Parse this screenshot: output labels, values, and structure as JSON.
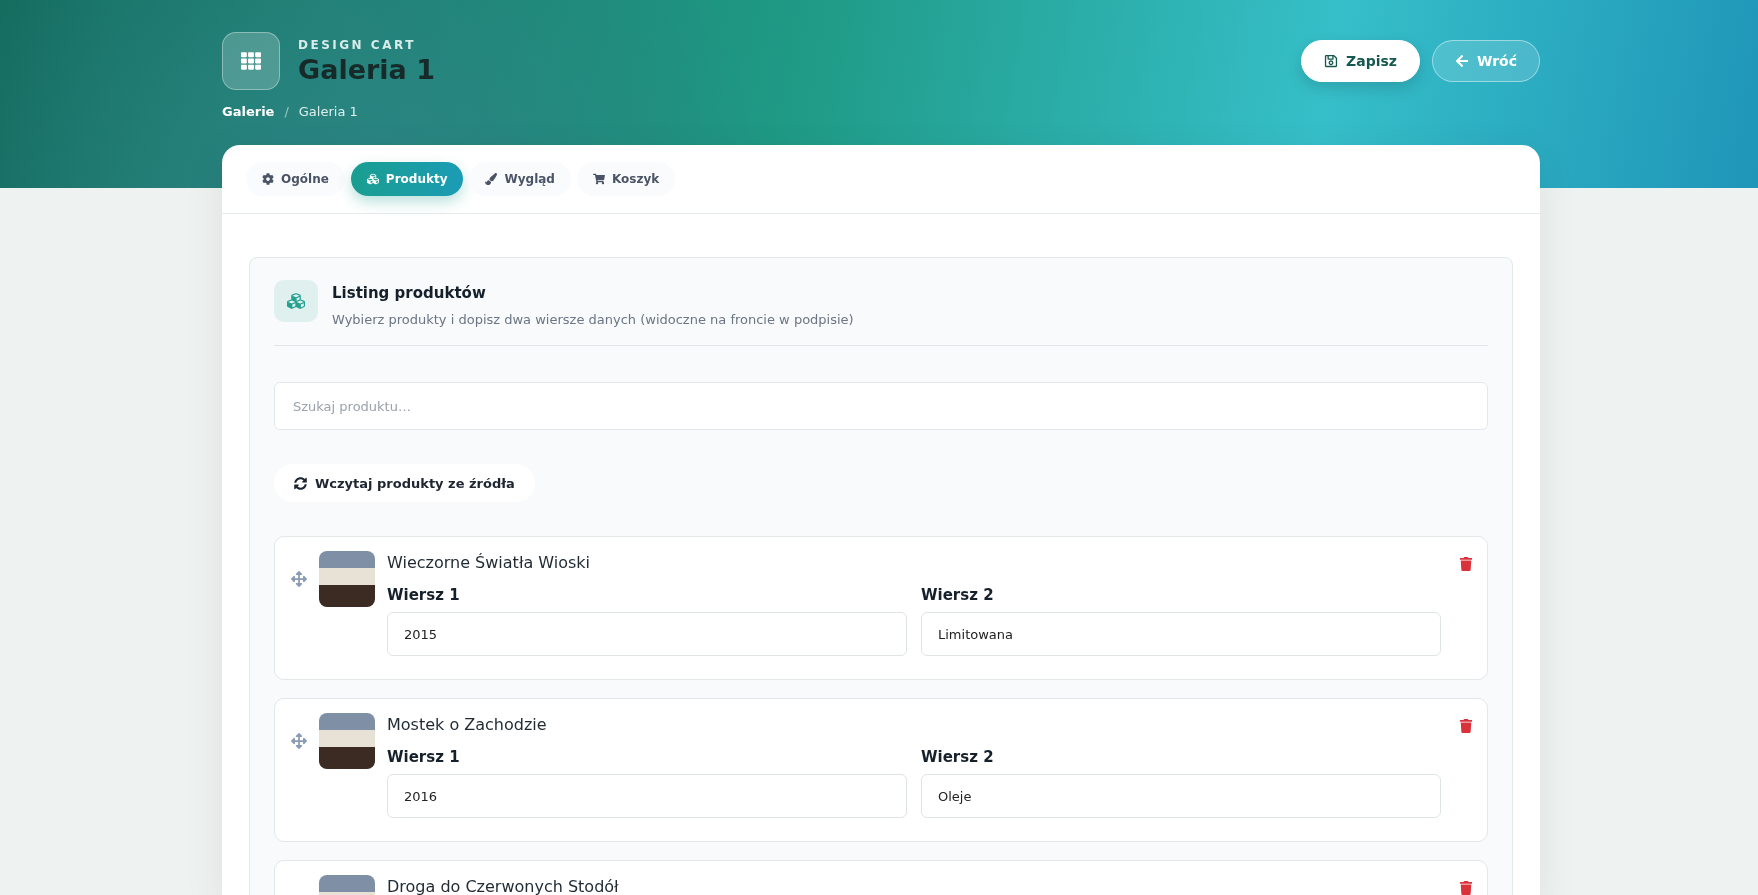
{
  "header": {
    "eyebrow": "DESIGN CART",
    "title": "Galeria 1",
    "breadcrumb_separator": "/",
    "breadcrumbs": [
      {
        "label": "Galerie",
        "current": false
      },
      {
        "label": "Galeria 1",
        "current": true
      }
    ],
    "actions": [
      {
        "kind": "primary",
        "label": "Zapisz"
      },
      {
        "kind": "secondary",
        "label": "Wróć"
      }
    ]
  },
  "tabs": [
    {
      "label": "Ogólne",
      "kind": "general",
      "selected": false
    },
    {
      "label": "Produkty",
      "kind": "products",
      "selected": true
    },
    {
      "label": "Wygląd",
      "kind": "appearance",
      "selected": false
    },
    {
      "label": "Koszyk",
      "kind": "cart",
      "selected": false
    }
  ],
  "listing": {
    "title": "Listing produktów",
    "subtitle": "Wybierz produkty i dopisz dwa wiersze danych (widoczne na froncie w podpisie)",
    "search": {
      "placeholder": "Szukaj produktu…"
    },
    "load_button": "Wczytaj produkty ze źródła",
    "products": [
      {
        "name": "Wieczorne Światła Wioski",
        "fields": [
          {
            "label": "Wiersz 1",
            "value": "2015"
          },
          {
            "label": "Wiersz 2",
            "value": "Limitowana"
          }
        ]
      },
      {
        "name": "Mostek o Zachodzie",
        "fields": [
          {
            "label": "Wiersz 1",
            "value": "2016"
          },
          {
            "label": "Wiersz 2",
            "value": "Oleje"
          }
        ]
      },
      {
        "name": "Droga do Czerwonych Stodół"
      }
    ]
  }
}
